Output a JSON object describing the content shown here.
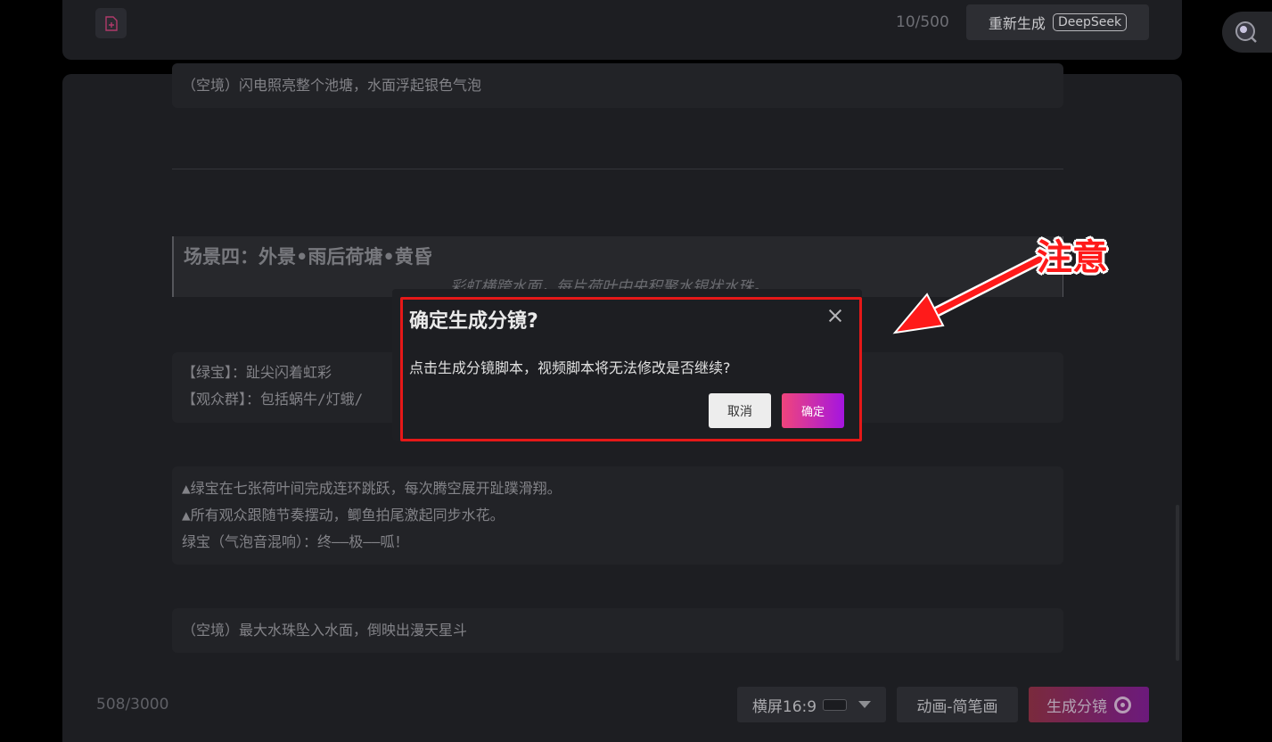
{
  "header": {
    "char_count": "10/500",
    "regen_label": "重新生成",
    "model_tag": "DeepSeek"
  },
  "script": {
    "block1": "（空境）闪电照亮整个池塘，水面浮起银色气泡",
    "scene_title": "场景四：外景•雨后荷塘•黄昏",
    "scene_subtitle": "彩虹横跨水面，每片荷叶中央积聚水银状水珠。",
    "roles_line1": "【绿宝】：趾尖闪着虹彩",
    "roles_line2": "【观众群】：包括蜗牛/灯蛾/",
    "action_line1": "▲绿宝在七张荷叶间完成连环跳跃，每次腾空展开趾蹼滑翔。",
    "action_line2": "▲所有观众跟随节奏摆动，鲫鱼拍尾激起同步水花。",
    "action_line3": "绿宝（气泡音混响）：终——极——呱！",
    "block_last": "（空境）最大水珠坠入水面，倒映出漫天星斗"
  },
  "footer": {
    "char_count": "508/3000",
    "ratio_label": "横屏16:9",
    "style_label": "动画-简笔画",
    "generate_label": "生成分镜"
  },
  "dialog": {
    "title": "确定生成分镜?",
    "message": "点击生成分镜脚本，视频脚本将无法修改是否继续?",
    "cancel_label": "取消",
    "confirm_label": "确定"
  },
  "annotation": {
    "label": "注意",
    "color": "#ff1a1a"
  },
  "colors": {
    "accent_start": "#f0457c",
    "accent_end": "#a415e0",
    "highlight_border": "#e51818"
  }
}
